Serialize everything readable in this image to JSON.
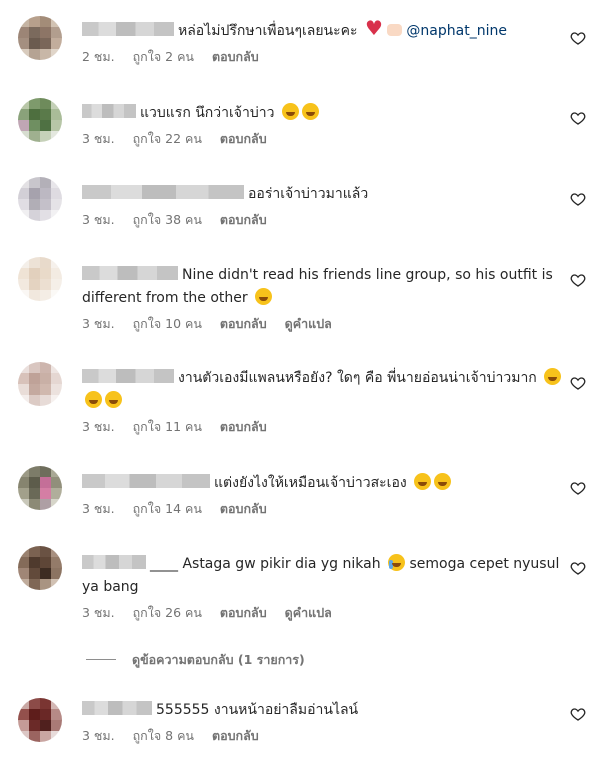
{
  "comments": [
    {
      "avatar": [
        "#c5b4a3",
        "#b7a08c",
        "#a38c78",
        "#d2c3b3",
        "#9c8576",
        "#7b6a5d",
        "#8d7566",
        "#b29e8e",
        "#a48f80",
        "#6b5b4f",
        "#7a6659",
        "#c2ad9c",
        "#d8cbbd",
        "#b5a393",
        "#c8b7a7",
        "#e0d5c9"
      ],
      "text": "หล่อไม่ปรึกษาเพื่อนๆเลยนะคะ",
      "emojis": [
        "heart",
        "hands"
      ],
      "mention": "@naphat_nine",
      "time": "2 ชม.",
      "likes": "ถูกใจ 2 คน",
      "reply": "ตอบกลับ",
      "translate": ""
    },
    {
      "avatar": [
        "#b9c7a8",
        "#7e9a6c",
        "#6e8b5b",
        "#c4d0b7",
        "#8aa27a",
        "#4e6f3f",
        "#5a7a4a",
        "#a9bc98",
        "#c0a6b4",
        "#6f8f61",
        "#4f7143",
        "#b7c6a7",
        "#d7ddd0",
        "#9fb08f",
        "#c6d1b9",
        "#e4e8df"
      ],
      "text": "แวบแรก นึกว่าเจ้าบ่าว",
      "emojis": [
        "grin",
        "grin"
      ],
      "mention": "",
      "time": "3 ชม.",
      "likes": "ถูกใจ 22 คน",
      "reply": "ตอบกลับ",
      "translate": ""
    },
    {
      "avatar": [
        "#e3e1e4",
        "#c8c6cc",
        "#b3b0b8",
        "#e8e6ea",
        "#d2cfd6",
        "#a6a2ad",
        "#bcb8c2",
        "#dedbe1",
        "#e0dde3",
        "#b1aeb6",
        "#c4c0c9",
        "#e5e3e7",
        "#f0eff1",
        "#d5d2d9",
        "#e2dfe5",
        "#f2f1f3"
      ],
      "text": "ออร่าเจ้าบ่าวมาแล้ว",
      "emojis": [],
      "mention": "",
      "time": "3 ชม.",
      "likes": "ถูกใจ 38 คน",
      "reply": "ตอบกลับ",
      "translate": ""
    },
    {
      "avatar": [
        "#f4efe9",
        "#ede2d6",
        "#e8dacb",
        "#f6f1ec",
        "#efe3d5",
        "#e2d0bd",
        "#e9dac9",
        "#f3ebe2",
        "#f2e9df",
        "#e4d3c1",
        "#ecdfd1",
        "#f5efe8",
        "#faf7f4",
        "#f1e8de",
        "#f4ede5",
        "#fbf9f6"
      ],
      "text": "Nine didn't read his friends line group, so his outfit is different from the other",
      "emojis": [
        "rofl"
      ],
      "mention": "",
      "time": "3 ชม.",
      "likes": "ถูกใจ 10 คน",
      "reply": "ตอบกลับ",
      "translate": "ดูคำแปล"
    },
    {
      "avatar": [
        "#eadfdc",
        "#d9c6c0",
        "#cdb5ad",
        "#eee5e2",
        "#d8c2ba",
        "#bfa298",
        "#c9b0a6",
        "#e5d7d2",
        "#e9ddd8",
        "#c4a99f",
        "#d0b8ae",
        "#ece2de",
        "#f4eeec",
        "#dccbc5",
        "#e7dbd7",
        "#f6f1ef"
      ],
      "text": "งานตัวเองมีแพลนหรือยัง? ใดๆ คือ พี่นายอ่อนน่าเจ้าบ่าวมาก",
      "emojis": [
        "grin",
        "grin",
        "grin"
      ],
      "mention": "",
      "time": "3 ชม.",
      "likes": "ถูกใจ 11 คน",
      "reply": "ตอบกลับ",
      "translate": ""
    },
    {
      "avatar": [
        "#9c9a86",
        "#7d7c69",
        "#6e6d5c",
        "#a9a895",
        "#86846f",
        "#5d5c4b",
        "#c46f98",
        "#918f7b",
        "#a2a08b",
        "#6a6957",
        "#d47ea4",
        "#b0ae9b",
        "#c9c8ba",
        "#8c8a76",
        "#ae9fa4",
        "#d6d5c9"
      ],
      "text": "แต่งยังไงให้เหมือนเจ้าบ่าวสะเอง",
      "emojis": [
        "grin",
        "grin"
      ],
      "mention": "",
      "time": "3 ชม.",
      "likes": "ถูกใจ 14 คน",
      "reply": "ตอบกลับ",
      "translate": ""
    },
    {
      "avatar": [
        "#9a8270",
        "#7b6251",
        "#6a5243",
        "#a89080",
        "#846b59",
        "#4f3a2d",
        "#5e4637",
        "#947b69",
        "#a08676",
        "#624a3b",
        "#3d2c22",
        "#8c7462",
        "#c0ac9c",
        "#7f6756",
        "#a99482",
        "#d1c1b3"
      ],
      "text": "____ Astaga gw pikir dia yg nikah",
      "text2": "semoga cepet nyusul ya bang",
      "emojis": [
        "cry"
      ],
      "mention": "",
      "time": "3 ชม.",
      "likes": "ถูกใจ 26 คน",
      "reply": "ตอบกลับ",
      "translate": "ดูคำแปล"
    },
    {
      "avatar": [
        "#c9a8a4",
        "#8c4b48",
        "#7a3532",
        "#d3b7b4",
        "#93504c",
        "#5e1d1b",
        "#6a2826",
        "#b68a86",
        "#c49b97",
        "#6b2a28",
        "#50201e",
        "#a97a76",
        "#dcc7c5",
        "#9b6460",
        "#c9a6a2",
        "#e8dcdb"
      ],
      "text": "555555 งานหน้าอย่าลืมอ่านไลน์",
      "emojis": [],
      "mention": "",
      "time": "3 ชม.",
      "likes": "ถูกใจ 8 คน",
      "reply": "ตอบกลับ",
      "translate": ""
    }
  ],
  "view_replies": "ดูข้อความตอบกลับ (1 รายการ)"
}
